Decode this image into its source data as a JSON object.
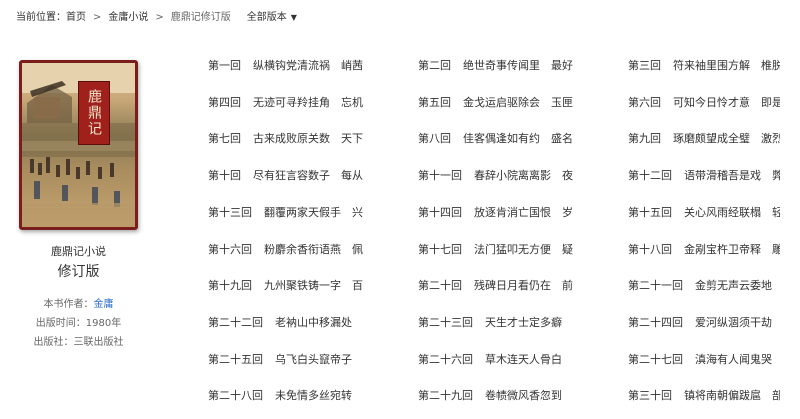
{
  "breadcrumb": {
    "prefix": "当前位置：",
    "home": "首页",
    "sep": ">",
    "category": "金庸小说",
    "current": "鹿鼎记修订版",
    "versions": "全部版本"
  },
  "book": {
    "cover_title": "鹿鼎记",
    "title": "鹿鼎记小说",
    "edition": "修订版",
    "author_label": "本书作者：",
    "author": "金庸",
    "date_label": "出版时间：",
    "date": "1980年",
    "publisher_label": "出版社：",
    "publisher": "三联出版社"
  },
  "chapters": [
    {
      "num": "第一回",
      "title": "纵横钩党清流祸　峭茜"
    },
    {
      "num": "第二回",
      "title": "绝世奇事传闻里　最好"
    },
    {
      "num": "第三回",
      "title": "符来袖里围方解　椎脱"
    },
    {
      "num": "第四回",
      "title": "无迹可寻羚挂角　忘机"
    },
    {
      "num": "第五回",
      "title": "金戈运启驱除会　玉匣"
    },
    {
      "num": "第六回",
      "title": "可知今日怜才意　即是"
    },
    {
      "num": "第七回",
      "title": "古来成败原关数　天下"
    },
    {
      "num": "第八回",
      "title": "佳客偶逢如有约　盛名"
    },
    {
      "num": "第九回",
      "title": "琢磨颇望成全璧　激烈"
    },
    {
      "num": "第十回",
      "title": "尽有狂言容数子　每从"
    },
    {
      "num": "第十一回",
      "title": "春辞小院离离影　夜"
    },
    {
      "num": "第十二回",
      "title": "语带滑稽吾是戏　弊"
    },
    {
      "num": "第十三回",
      "title": "翻覆两家天假手　兴"
    },
    {
      "num": "第十四回",
      "title": "放逐肯消亡国恨　岁"
    },
    {
      "num": "第十五回",
      "title": "关心风雨经联榻　轻"
    },
    {
      "num": "第十六回",
      "title": "粉麝余香衔语燕　佩"
    },
    {
      "num": "第十七回",
      "title": "法门猛叩无方便　疑"
    },
    {
      "num": "第十八回",
      "title": "金剐宝杵卫帝释　雕"
    },
    {
      "num": "第十九回",
      "title": "九州聚铁铸一字　百"
    },
    {
      "num": "第二十回",
      "title": "残碑日月看仍在　前"
    },
    {
      "num": "第二十一回",
      "title": "金剪无声云委地"
    },
    {
      "num": "第二十二回",
      "title": "老衲山中移漏处"
    },
    {
      "num": "第二十三回",
      "title": "天生才士定多癖"
    },
    {
      "num": "第二十四回",
      "title": "爱河纵涸须干劫"
    },
    {
      "num": "第二十五回",
      "title": "乌飞白头竄帝子"
    },
    {
      "num": "第二十六回",
      "title": "草木连天人骨白"
    },
    {
      "num": "第二十七回",
      "title": "滇海有人闻鬼哭"
    },
    {
      "num": "第二十八回",
      "title": "未免情多丝宛转"
    },
    {
      "num": "第二十九回",
      "title": "卷帻微风香忽到"
    },
    {
      "num": "第三十回",
      "title": "镇将南朝偏跋扈　部"
    }
  ]
}
